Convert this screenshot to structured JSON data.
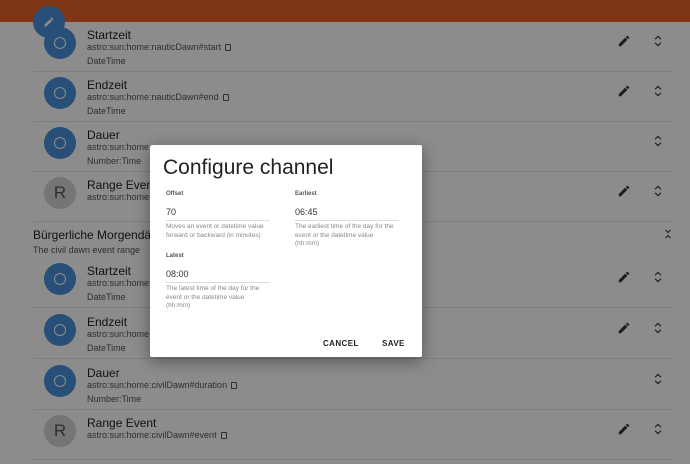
{
  "channels": [
    {
      "title": "Startzeit",
      "uid": "astro:sun:home:nauticDawn#start",
      "type": "DateTime",
      "avatar": "circle",
      "editable": true
    },
    {
      "title": "Endzeit",
      "uid": "astro:sun:home:nauticDawn#end",
      "type": "DateTime",
      "avatar": "circle",
      "editable": true
    },
    {
      "title": "Dauer",
      "uid": "astro:sun:home:na",
      "type": "Number:Time",
      "avatar": "circle",
      "editable": false
    },
    {
      "title": "Range Event",
      "uid": "astro:sun:home:na",
      "type": "",
      "avatar": "R",
      "editable": true
    }
  ],
  "section": {
    "title": "Bürgerliche Morgendäm",
    "description": "The civil dawn event range"
  },
  "channels2": [
    {
      "title": "Startzeit",
      "uid": "astro:sun:home:civi",
      "type": "DateTime",
      "avatar": "circle",
      "editable": true
    },
    {
      "title": "Endzeit",
      "uid": "astro:sun:home:civ",
      "type": "DateTime",
      "avatar": "circle",
      "editable": true
    },
    {
      "title": "Dauer",
      "uid": "astro:sun:home:civilDawn#duration",
      "type": "Number:Time",
      "avatar": "circle",
      "editable": false
    },
    {
      "title": "Range Event",
      "uid": "astro:sun:home:civilDawn#event",
      "type": "",
      "avatar": "R",
      "editable": true
    }
  ],
  "dialog": {
    "title": "Configure channel",
    "fields": [
      {
        "label": "Offset",
        "value": "70",
        "hint": "Moves an event or datetime value forward or backward (in minutes)"
      },
      {
        "label": "Earliest",
        "value": "06:45",
        "hint": "The earliest time of the day for the event or the datetime value (hh:mm)"
      },
      {
        "label": "Latest",
        "value": "08:00",
        "hint": "The latest time of the day for the event or the datetime value (hh:mm)"
      }
    ],
    "cancel_label": "CANCEL",
    "save_label": "SAVE"
  },
  "colors": {
    "topbar": "#e8632a",
    "accent": "#4a90d9"
  }
}
